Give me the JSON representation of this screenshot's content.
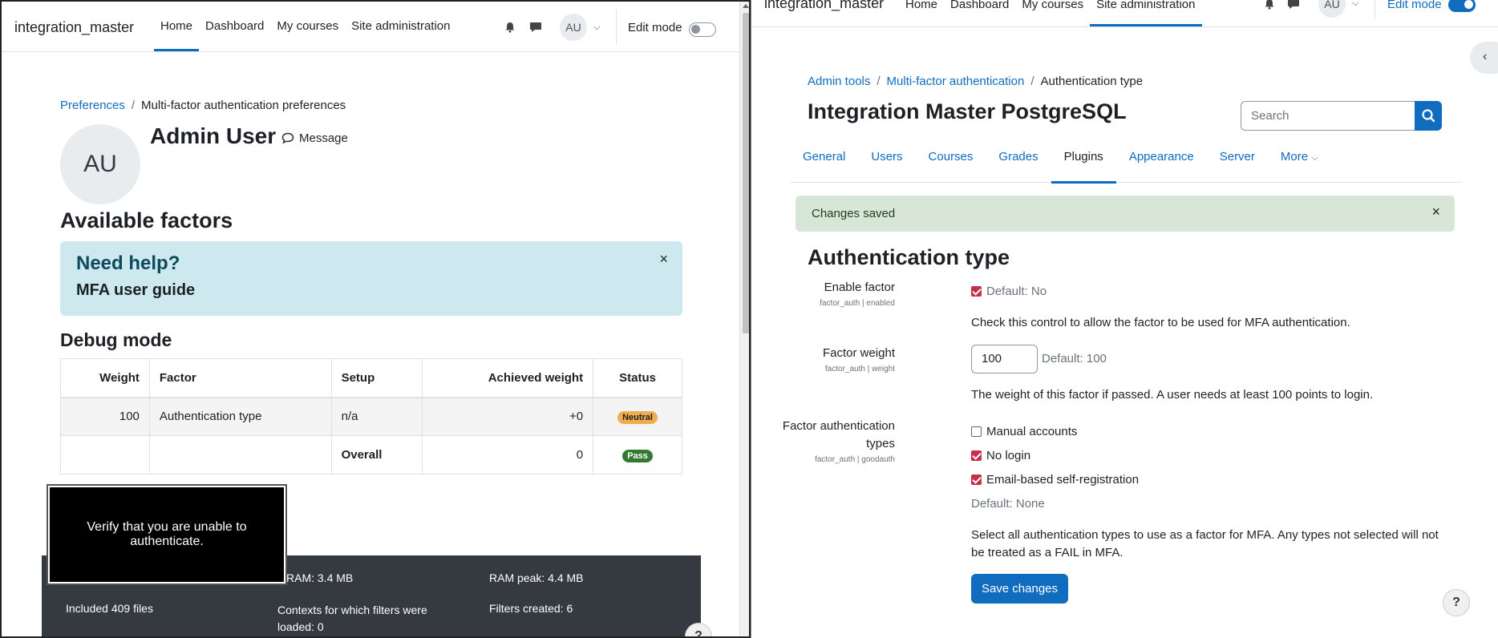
{
  "left": {
    "brand": "integration_master",
    "nav": [
      "Home",
      "Dashboard",
      "My courses",
      "Site administration"
    ],
    "avatar_initials": "AU",
    "edit_mode_label": "Edit mode",
    "breadcrumb": {
      "link": "Preferences",
      "sep": "/",
      "current": "Multi-factor authentication preferences"
    },
    "user": {
      "initials": "AU",
      "name": "Admin User",
      "message_label": "Message"
    },
    "available_factors_heading": "Available factors",
    "help": {
      "title": "Need help?",
      "link": "MFA user guide",
      "close": "×"
    },
    "debug_heading": "Debug mode",
    "table": {
      "headers": [
        "Weight",
        "Factor",
        "Setup",
        "Achieved weight",
        "Status"
      ],
      "row": {
        "weight": "100",
        "factor": "Authentication type",
        "setup": "n/a",
        "achieved": "+0",
        "status": "Neutral"
      },
      "overall": {
        "label": "Overall",
        "achieved": "0",
        "status": "Pass"
      }
    },
    "tooltip": "Verify that you are unable to authenticate.",
    "footer": {
      "ram": "RAM: 3.4 MB",
      "ram_peak": "RAM peak: 4.4 MB",
      "included": "Included 409 files",
      "contexts": "Contexts for which filters were loaded: 0",
      "filters": "Filters created: 6"
    },
    "help_circle": "?"
  },
  "right": {
    "brand": "integration_master",
    "nav": [
      "Home",
      "Dashboard",
      "My courses",
      "Site administration"
    ],
    "avatar_initials": "AU",
    "edit_mode_label": "Edit mode",
    "drawer_toggle": "‹",
    "breadcrumb": {
      "crumb1": "Admin tools",
      "crumb2": "Multi-factor authentication",
      "current": "Authentication type",
      "sep": "/"
    },
    "site_title": "Integration Master PostgreSQL",
    "search_placeholder": "Search",
    "tabs": [
      "General",
      "Users",
      "Courses",
      "Grades",
      "Plugins",
      "Appearance",
      "Server",
      "More"
    ],
    "alert": {
      "text": "Changes saved",
      "close": "×"
    },
    "heading": "Authentication type",
    "enable_factor": {
      "label": "Enable factor",
      "sub": "factor_auth | enabled",
      "default": "Default: No",
      "desc": "Check this control to allow the factor to be used for MFA authentication."
    },
    "factor_weight": {
      "label": "Factor weight",
      "sub": "factor_auth | weight",
      "value": "100",
      "default": "Default: 100",
      "desc": "The weight of this factor if passed. A user needs at least 100 points to login."
    },
    "auth_types": {
      "label_line1": "Factor authentication",
      "label_line2": "types",
      "sub": "factor_auth | goodauth",
      "options": [
        "Manual accounts",
        "No login",
        "Email-based self-registration"
      ],
      "default": "Default: None",
      "desc_line1": "Select all authentication types to use as a factor for MFA. Any types not selected will not",
      "desc_line2": "be treated as a FAIL in MFA."
    },
    "save_button": "Save changes",
    "help_circle": "?"
  },
  "colors": {
    "primary": "#0f6cbf",
    "danger_check": "#c62f48",
    "success_alert": "#d7e6d7",
    "info_box": "#cde8ee"
  }
}
